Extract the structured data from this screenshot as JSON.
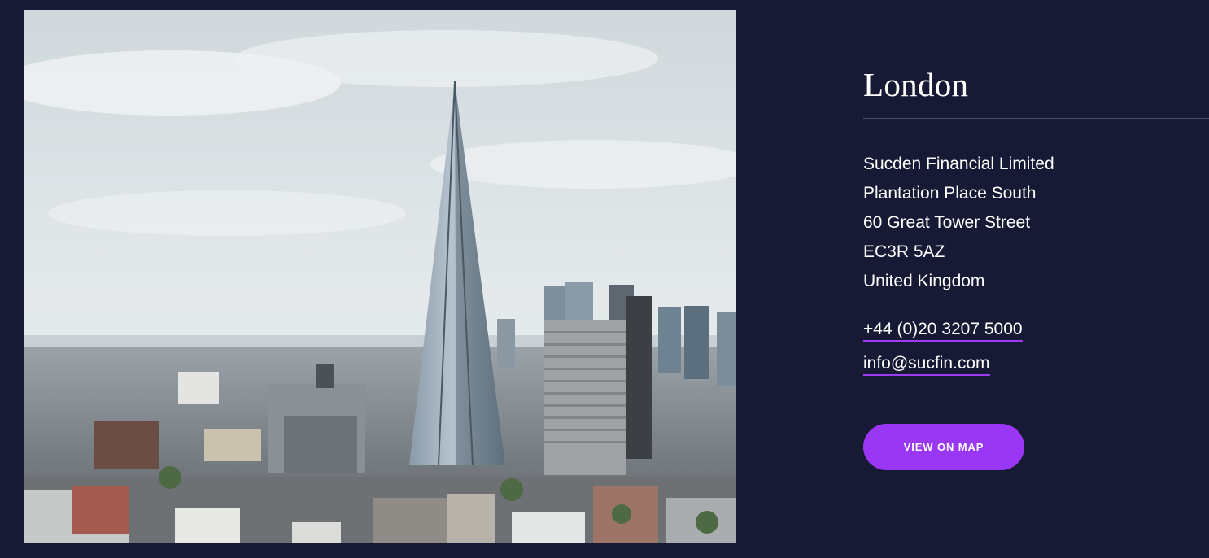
{
  "office": {
    "city": "London",
    "address_lines": [
      "Sucden Financial Limited",
      "Plantation Place South",
      "60 Great Tower Street",
      "EC3R 5AZ",
      "United Kingdom"
    ],
    "phone": "+44 (0)20 3207 5000",
    "email": "info@sucfin.com",
    "map_button_label": "VIEW ON MAP"
  },
  "colors": {
    "background": "#161a34",
    "accent": "#9a37f5",
    "divider": "#4a4f68",
    "text": "#ffffff"
  },
  "photo": {
    "subject": "london-skyline-shard"
  }
}
